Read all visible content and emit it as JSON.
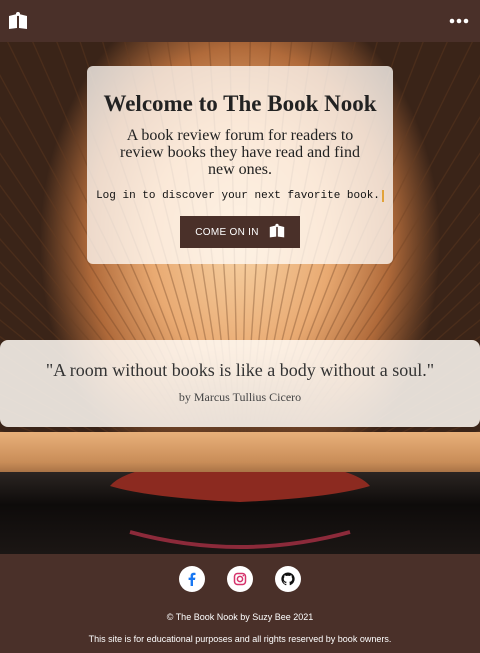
{
  "nav": {
    "logo_icon": "open-book-icon",
    "menu_icon": "more-dots-icon"
  },
  "hero": {
    "title": "Welcome to The Book Nook",
    "subtitle": "A book review forum for readers to review books they have read and find new ones.",
    "cta_text": "Log in to discover your next favorite book.",
    "button_label": "COME ON IN",
    "button_icon": "open-book-icon"
  },
  "quote": {
    "text": "\"A room without books is like a body without a soul.\"",
    "author": "by Marcus Tullius Cicero"
  },
  "footer": {
    "socials": [
      {
        "name": "facebook",
        "color": "#1877f2"
      },
      {
        "name": "instagram",
        "color": "#d6336c"
      },
      {
        "name": "github",
        "color": "#111111"
      }
    ],
    "copyright": "© The Book Nook by Suzy Bee 2021",
    "disclaimer": "This site is for educational purposes and all rights reserved by book owners."
  },
  "colors": {
    "brand": "#4a3029",
    "accent": "#e2a33a"
  }
}
